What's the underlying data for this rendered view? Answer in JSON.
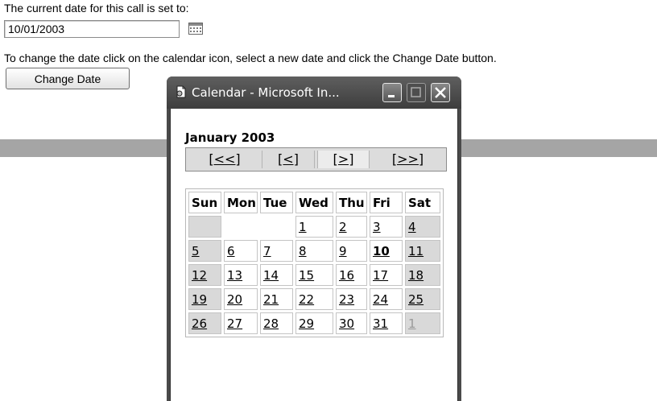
{
  "main": {
    "line1": "The current date for this call is set to:",
    "date_value": "10/01/2003",
    "instruction": "To change the date click on the calendar icon, select a new date and click the Change Date button.",
    "change_button": "Change Date",
    "calendar_icon": "calendar-icon"
  },
  "popup": {
    "title": "Calendar - Microsoft In...",
    "month_year": "January 2003",
    "nav": {
      "first": "[<<]",
      "prev": "[<]",
      "next": "[>]",
      "last": "[>>]"
    },
    "weekdays": [
      "Sun",
      "Mon",
      "Tue",
      "Wed",
      "Thu",
      "Fri",
      "Sat"
    ],
    "weeks": [
      [
        {
          "t": "",
          "c": "we"
        },
        {
          "t": "",
          "c": "empty"
        },
        {
          "t": "",
          "c": "empty"
        },
        {
          "t": "1",
          "c": ""
        },
        {
          "t": "2",
          "c": ""
        },
        {
          "t": "3",
          "c": ""
        },
        {
          "t": "4",
          "c": "we"
        }
      ],
      [
        {
          "t": "5",
          "c": "we"
        },
        {
          "t": "6",
          "c": ""
        },
        {
          "t": "7",
          "c": ""
        },
        {
          "t": "8",
          "c": ""
        },
        {
          "t": "9",
          "c": ""
        },
        {
          "t": "10",
          "c": "today"
        },
        {
          "t": "11",
          "c": "we"
        }
      ],
      [
        {
          "t": "12",
          "c": "we"
        },
        {
          "t": "13",
          "c": ""
        },
        {
          "t": "14",
          "c": ""
        },
        {
          "t": "15",
          "c": ""
        },
        {
          "t": "16",
          "c": ""
        },
        {
          "t": "17",
          "c": ""
        },
        {
          "t": "18",
          "c": "we"
        }
      ],
      [
        {
          "t": "19",
          "c": "we"
        },
        {
          "t": "20",
          "c": ""
        },
        {
          "t": "21",
          "c": ""
        },
        {
          "t": "22",
          "c": ""
        },
        {
          "t": "23",
          "c": ""
        },
        {
          "t": "24",
          "c": ""
        },
        {
          "t": "25",
          "c": "we"
        }
      ],
      [
        {
          "t": "26",
          "c": "we"
        },
        {
          "t": "27",
          "c": ""
        },
        {
          "t": "28",
          "c": ""
        },
        {
          "t": "29",
          "c": ""
        },
        {
          "t": "30",
          "c": ""
        },
        {
          "t": "31",
          "c": ""
        },
        {
          "t": "1",
          "c": "we other"
        }
      ]
    ]
  },
  "colors": {
    "titlebar": "#4a4a4a",
    "weekend_cell": "#d9d9d9",
    "band": "#a5a5a5"
  }
}
